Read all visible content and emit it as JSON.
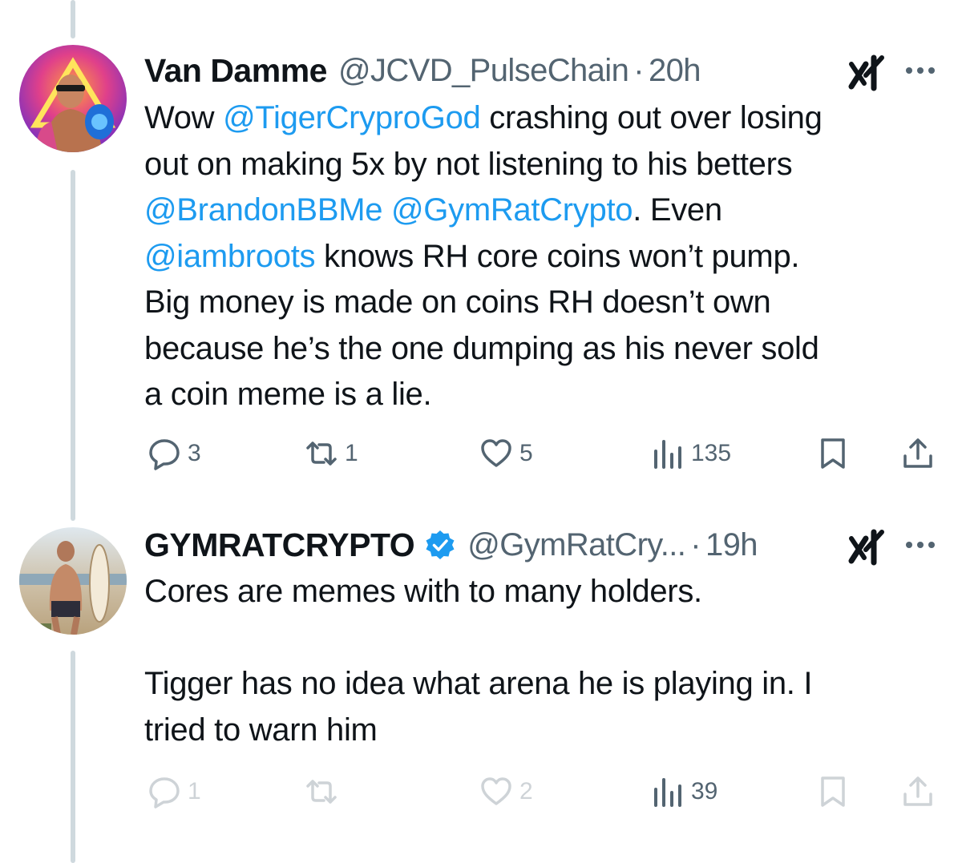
{
  "tweets": [
    {
      "author": {
        "name": "Van Damme",
        "handle": "@JCVD_PulseChain",
        "verified": false
      },
      "separator": "·",
      "time": "20h",
      "body_lines": [
        [
          {
            "text": "Wow ",
            "mention": false
          },
          {
            "text": "@TigerCryproGod",
            "mention": true
          },
          {
            "text": " crashing out over losing",
            "mention": false
          }
        ],
        [
          {
            "text": "out on making 5x by not listening to his betters",
            "mention": false
          }
        ],
        [
          {
            "text": "@BrandonBBMe",
            "mention": true
          },
          {
            "text": " ",
            "mention": false
          },
          {
            "text": "@GymRatCrypto",
            "mention": true
          },
          {
            "text": ". Even",
            "mention": false
          }
        ],
        [
          {
            "text": "@iambroots",
            "mention": true
          },
          {
            "text": " knows RH core coins won’t pump.",
            "mention": false
          }
        ],
        [
          {
            "text": "Big money is made on coins RH doesn’t own",
            "mention": false
          }
        ],
        [
          {
            "text": "because he’s the one dumping as his never sold",
            "mention": false
          }
        ],
        [
          {
            "text": "a coin meme is a lie.",
            "mention": false
          }
        ]
      ],
      "actions": {
        "replies": "3",
        "reposts": "1",
        "likes": "5",
        "views": "135"
      }
    },
    {
      "author": {
        "name": "GYMRATCRYPTO",
        "handle": "@GymRatCry...",
        "verified": true
      },
      "separator": "·",
      "time": "19h",
      "body_lines": [
        [
          {
            "text": "Cores are memes with to many holders.",
            "mention": false
          }
        ],
        [
          {
            "text": "",
            "mention": false
          }
        ],
        [
          {
            "text": "Tigger has no idea what arena he is playing in. I",
            "mention": false
          }
        ],
        [
          {
            "text": "tried to warn him",
            "mention": false
          }
        ]
      ],
      "actions": {
        "replies": "1",
        "reposts": "",
        "likes": "2",
        "views": "39"
      }
    }
  ],
  "icons": {
    "reply": "reply-icon",
    "repost": "repost-icon",
    "like": "heart-icon",
    "views": "views-icon",
    "bookmark": "bookmark-icon",
    "share": "share-icon",
    "grok": "grok-icon",
    "more": "more-icon",
    "verified": "verified-badge-icon"
  },
  "colors": {
    "text": "#0f1419",
    "muted": "#536471",
    "link": "#1d9bf0",
    "thread_line": "#cfd9de"
  }
}
